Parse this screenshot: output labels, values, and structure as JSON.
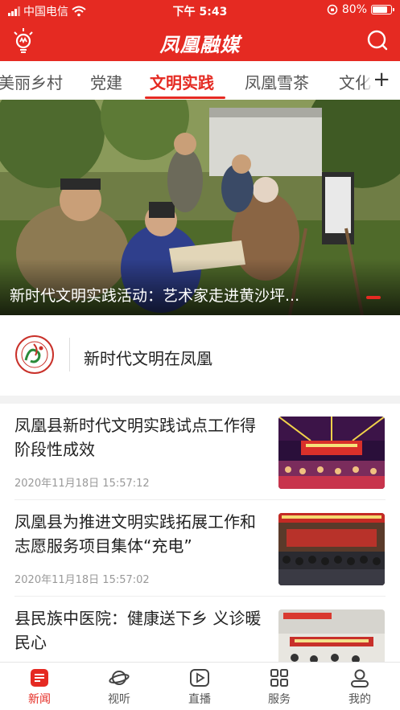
{
  "status_bar": {
    "carrier": "中国电信",
    "time": "下午 5:43",
    "battery": "80%",
    "battery_level": 0.8
  },
  "header": {
    "title": "凤凰融媒",
    "left_icon": "lightbulb-icon",
    "right_icon": "search-icon"
  },
  "tabs": [
    {
      "label": "美丽乡村"
    },
    {
      "label": "党建"
    },
    {
      "label": "文明实践"
    },
    {
      "label": "凤凰雪茶"
    },
    {
      "label": "文化"
    }
  ],
  "active_tab": "文明实践",
  "hero": {
    "caption": "新时代文明实践活动：艺术家走进黄沙坪..."
  },
  "column": {
    "name": "新时代文明在凤凰",
    "logo_icon": "civilization-practice-logo-icon"
  },
  "news": [
    {
      "title": "凤凰县新时代文明实践试点工作得阶段性成效",
      "time": "2020年11月18日 15:57:12",
      "thumb": "stage-performance"
    },
    {
      "title": "凤凰县为推进文明实践拓展工作和志愿服务项目集体“充电”",
      "time": "2020年11月18日 15:57:02",
      "thumb": "meeting-hall"
    },
    {
      "title": "县民族中医院：健康送下乡 义诊暖民心",
      "time": "",
      "thumb": "outdoor-clinic"
    }
  ],
  "bottom_nav": [
    {
      "label": "新闻",
      "icon": "news-icon",
      "active": true
    },
    {
      "label": "视听",
      "icon": "planet-icon",
      "active": false
    },
    {
      "label": "直播",
      "icon": "play-icon",
      "active": false
    },
    {
      "label": "服务",
      "icon": "grid-icon",
      "active": false
    },
    {
      "label": "我的",
      "icon": "user-icon",
      "active": false
    }
  ],
  "colors": {
    "brand": "#e52a22",
    "text": "#222222",
    "muted": "#999999"
  }
}
